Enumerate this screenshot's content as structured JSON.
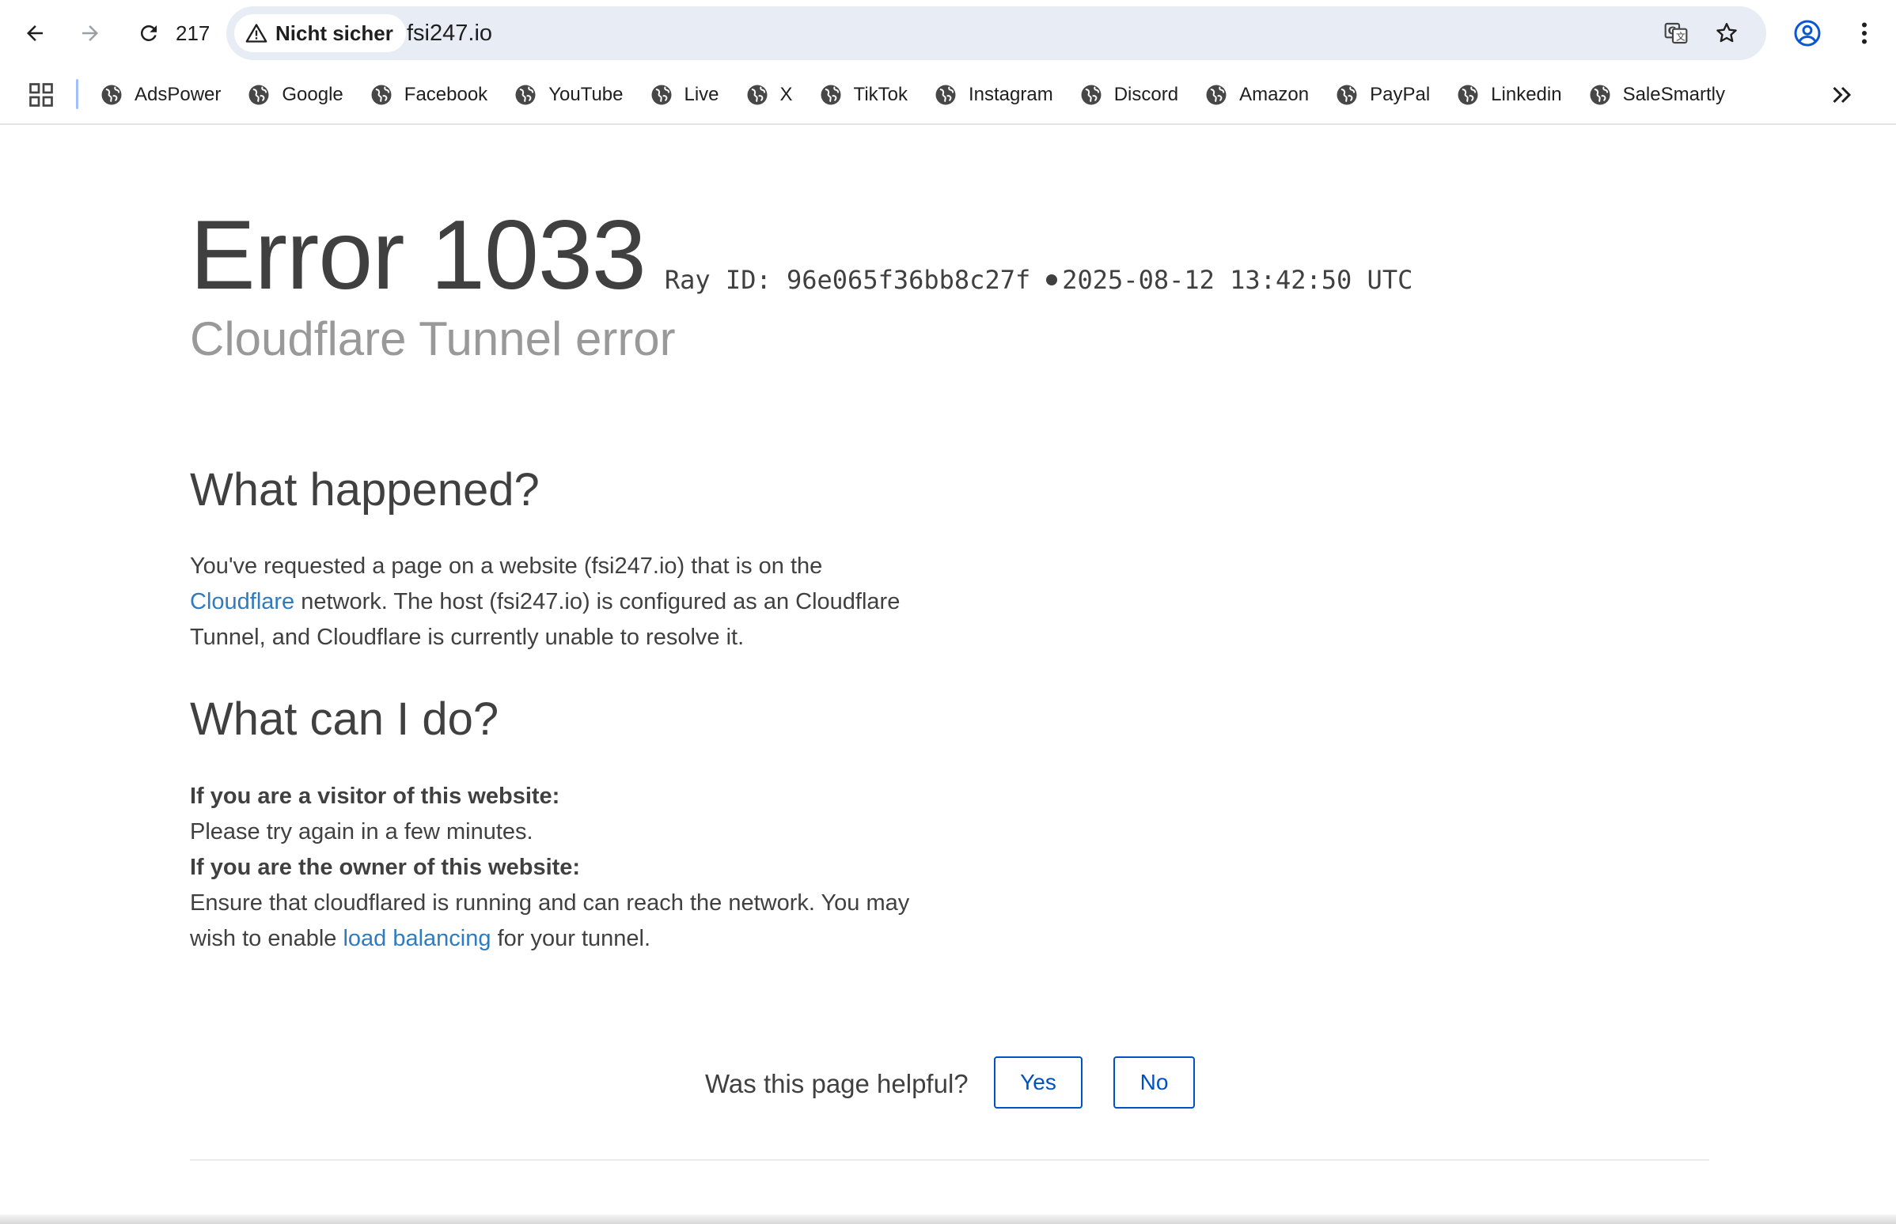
{
  "browser": {
    "tab_count": "217",
    "security_chip": "Nicht sicher",
    "url": "fsi247.io"
  },
  "bookmarks": [
    {
      "label": "AdsPower"
    },
    {
      "label": "Google"
    },
    {
      "label": "Facebook"
    },
    {
      "label": "YouTube"
    },
    {
      "label": "Live"
    },
    {
      "label": "X"
    },
    {
      "label": "TikTok"
    },
    {
      "label": "Instagram"
    },
    {
      "label": "Discord"
    },
    {
      "label": "Amazon"
    },
    {
      "label": "PayPal"
    },
    {
      "label": "Linkedin"
    },
    {
      "label": "SaleSmartly"
    }
  ],
  "error": {
    "title": "Error 1033",
    "ray_id": "Ray ID: 96e065f36bb8c27f",
    "timestamp": "2025-08-12 13:42:50 UTC",
    "subtitle": "Cloudflare Tunnel error"
  },
  "happened": {
    "heading": "What happened?",
    "text_1": "You've requested a page on a website (fsi247.io) that is on the",
    "link": "Cloudflare",
    "text_2": " network. The host (fsi247.io) is configured as an Cloudflare Tunnel, and Cloudflare is currently unable to resolve it."
  },
  "cando": {
    "heading": "What can I do?",
    "visitor_label": "If you are a visitor of this website:",
    "visitor_text": "Please try again in a few minutes.",
    "owner_label": "If you are the owner of this website:",
    "owner_text_1": "Ensure that cloudflared is running and can reach the network. You may wish to enable ",
    "owner_link": "load balancing",
    "owner_text_2": " for your tunnel."
  },
  "feedback": {
    "question": "Was this page helpful?",
    "yes": "Yes",
    "no": "No"
  },
  "colors": {
    "link": "#2f7bbf",
    "button_border": "#0051c3",
    "text": "#404040",
    "subtitle": "#999999"
  },
  "icons": [
    "back-arrow-icon",
    "forward-arrow-icon",
    "reload-icon",
    "warning-icon",
    "translate-icon",
    "star-icon",
    "profile-icon",
    "kebab-menu-icon",
    "apps-grid-icon",
    "globe-icon",
    "chevrons-right-icon"
  ]
}
